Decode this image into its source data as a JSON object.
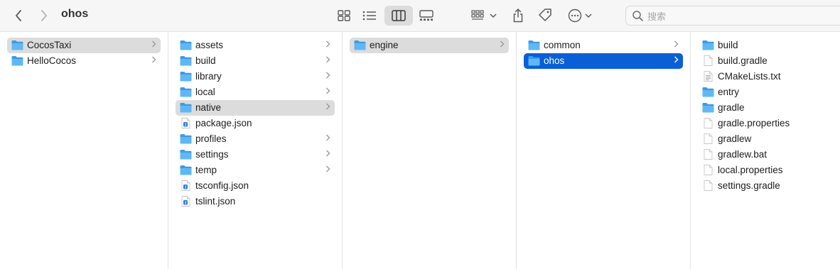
{
  "window": {
    "title": "ohos"
  },
  "search": {
    "placeholder": "搜索"
  },
  "columns": [
    {
      "items": [
        {
          "label": "CocosTaxi",
          "type": "folder",
          "chevron": true,
          "sel": "gray"
        },
        {
          "label": "HelloCocos",
          "type": "folder",
          "chevron": true
        }
      ]
    },
    {
      "items": [
        {
          "label": "assets",
          "type": "folder",
          "chevron": true
        },
        {
          "label": "build",
          "type": "folder",
          "chevron": true
        },
        {
          "label": "library",
          "type": "folder",
          "chevron": true
        },
        {
          "label": "local",
          "type": "folder",
          "chevron": true
        },
        {
          "label": "native",
          "type": "folder",
          "chevron": true,
          "sel": "gray"
        },
        {
          "label": "package.json",
          "type": "json"
        },
        {
          "label": "profiles",
          "type": "folder",
          "chevron": true
        },
        {
          "label": "settings",
          "type": "folder",
          "chevron": true
        },
        {
          "label": "temp",
          "type": "folder",
          "chevron": true
        },
        {
          "label": "tsconfig.json",
          "type": "json"
        },
        {
          "label": "tslint.json",
          "type": "json"
        }
      ]
    },
    {
      "items": [
        {
          "label": "engine",
          "type": "folder",
          "chevron": true,
          "sel": "gray"
        }
      ]
    },
    {
      "items": [
        {
          "label": "common",
          "type": "folder",
          "chevron": true
        },
        {
          "label": "ohos",
          "type": "folder",
          "chevron": true,
          "sel": "blue"
        }
      ]
    },
    {
      "items": [
        {
          "label": "build",
          "type": "folder"
        },
        {
          "label": "build.gradle",
          "type": "doc"
        },
        {
          "label": "CMakeLists.txt",
          "type": "text"
        },
        {
          "label": "entry",
          "type": "folder"
        },
        {
          "label": "gradle",
          "type": "folder"
        },
        {
          "label": "gradle.properties",
          "type": "doc"
        },
        {
          "label": "gradlew",
          "type": "doc"
        },
        {
          "label": "gradlew.bat",
          "type": "doc"
        },
        {
          "label": "local.properties",
          "type": "doc"
        },
        {
          "label": "settings.gradle",
          "type": "doc"
        }
      ]
    }
  ]
}
